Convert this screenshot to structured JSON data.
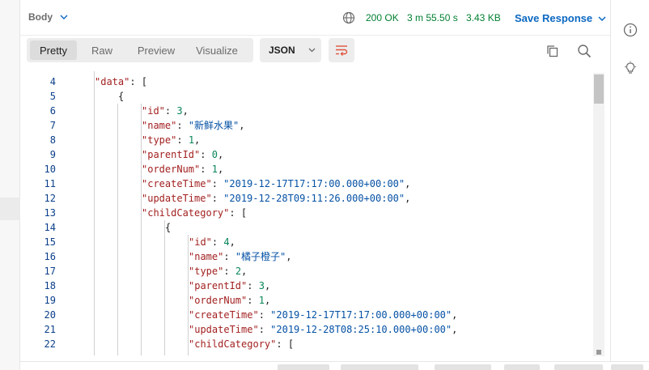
{
  "response": {
    "section_label": "Body",
    "status": "200 OK",
    "time": "3 m 55.50 s",
    "size": "3.43 KB",
    "save_label": "Save Response"
  },
  "view_tabs": [
    {
      "label": "Pretty",
      "active": true
    },
    {
      "label": "Raw",
      "active": false
    },
    {
      "label": "Preview",
      "active": false
    },
    {
      "label": "Visualize",
      "active": false
    }
  ],
  "format": {
    "selected": "JSON"
  },
  "icons": {
    "globe": "globe-icon",
    "wrap": "wrap-lines-icon",
    "copy": "copy-icon",
    "search": "search-icon",
    "info": "info-icon",
    "bulb": "lightbulb-icon"
  },
  "colors": {
    "status_ok": "#007f31",
    "accent": "#0b68c2",
    "wrap_icon": "#e0533d",
    "json_key": "#a32121",
    "json_string": "#0451a5",
    "json_number": "#098658"
  },
  "code_lines": [
    {
      "n": "4",
      "indent": 1,
      "tokens": [
        {
          "t": "key",
          "v": "\"data\""
        },
        {
          "t": "p",
          "v": ": ["
        }
      ]
    },
    {
      "n": "5",
      "indent": 2,
      "tokens": [
        {
          "t": "p",
          "v": "{"
        }
      ]
    },
    {
      "n": "6",
      "indent": 3,
      "tokens": [
        {
          "t": "key",
          "v": "\"id\""
        },
        {
          "t": "p",
          "v": ": "
        },
        {
          "t": "num",
          "v": "3"
        },
        {
          "t": "p",
          "v": ","
        }
      ]
    },
    {
      "n": "7",
      "indent": 3,
      "tokens": [
        {
          "t": "key",
          "v": "\"name\""
        },
        {
          "t": "p",
          "v": ": "
        },
        {
          "t": "str",
          "v": "\"新鲜水果\""
        },
        {
          "t": "p",
          "v": ","
        }
      ]
    },
    {
      "n": "8",
      "indent": 3,
      "tokens": [
        {
          "t": "key",
          "v": "\"type\""
        },
        {
          "t": "p",
          "v": ": "
        },
        {
          "t": "num",
          "v": "1"
        },
        {
          "t": "p",
          "v": ","
        }
      ]
    },
    {
      "n": "9",
      "indent": 3,
      "tokens": [
        {
          "t": "key",
          "v": "\"parentId\""
        },
        {
          "t": "p",
          "v": ": "
        },
        {
          "t": "num",
          "v": "0"
        },
        {
          "t": "p",
          "v": ","
        }
      ]
    },
    {
      "n": "10",
      "indent": 3,
      "tokens": [
        {
          "t": "key",
          "v": "\"orderNum\""
        },
        {
          "t": "p",
          "v": ": "
        },
        {
          "t": "num",
          "v": "1"
        },
        {
          "t": "p",
          "v": ","
        }
      ]
    },
    {
      "n": "11",
      "indent": 3,
      "tokens": [
        {
          "t": "key",
          "v": "\"createTime\""
        },
        {
          "t": "p",
          "v": ": "
        },
        {
          "t": "str",
          "v": "\"2019-12-17T17:17:00.000+00:00\""
        },
        {
          "t": "p",
          "v": ","
        }
      ]
    },
    {
      "n": "12",
      "indent": 3,
      "tokens": [
        {
          "t": "key",
          "v": "\"updateTime\""
        },
        {
          "t": "p",
          "v": ": "
        },
        {
          "t": "str",
          "v": "\"2019-12-28T09:11:26.000+00:00\""
        },
        {
          "t": "p",
          "v": ","
        }
      ]
    },
    {
      "n": "13",
      "indent": 3,
      "tokens": [
        {
          "t": "key",
          "v": "\"childCategory\""
        },
        {
          "t": "p",
          "v": ": ["
        }
      ]
    },
    {
      "n": "14",
      "indent": 4,
      "tokens": [
        {
          "t": "p",
          "v": "{"
        }
      ]
    },
    {
      "n": "15",
      "indent": 5,
      "tokens": [
        {
          "t": "key",
          "v": "\"id\""
        },
        {
          "t": "p",
          "v": ": "
        },
        {
          "t": "num",
          "v": "4"
        },
        {
          "t": "p",
          "v": ","
        }
      ]
    },
    {
      "n": "16",
      "indent": 5,
      "tokens": [
        {
          "t": "key",
          "v": "\"name\""
        },
        {
          "t": "p",
          "v": ": "
        },
        {
          "t": "str",
          "v": "\"橘子橙子\""
        },
        {
          "t": "p",
          "v": ","
        }
      ]
    },
    {
      "n": "17",
      "indent": 5,
      "tokens": [
        {
          "t": "key",
          "v": "\"type\""
        },
        {
          "t": "p",
          "v": ": "
        },
        {
          "t": "num",
          "v": "2"
        },
        {
          "t": "p",
          "v": ","
        }
      ]
    },
    {
      "n": "18",
      "indent": 5,
      "tokens": [
        {
          "t": "key",
          "v": "\"parentId\""
        },
        {
          "t": "p",
          "v": ": "
        },
        {
          "t": "num",
          "v": "3"
        },
        {
          "t": "p",
          "v": ","
        }
      ]
    },
    {
      "n": "19",
      "indent": 5,
      "tokens": [
        {
          "t": "key",
          "v": "\"orderNum\""
        },
        {
          "t": "p",
          "v": ": "
        },
        {
          "t": "num",
          "v": "1"
        },
        {
          "t": "p",
          "v": ","
        }
      ]
    },
    {
      "n": "20",
      "indent": 5,
      "tokens": [
        {
          "t": "key",
          "v": "\"createTime\""
        },
        {
          "t": "p",
          "v": ": "
        },
        {
          "t": "str",
          "v": "\"2019-12-17T17:17:00.000+00:00\""
        },
        {
          "t": "p",
          "v": ","
        }
      ]
    },
    {
      "n": "21",
      "indent": 5,
      "tokens": [
        {
          "t": "key",
          "v": "\"updateTime\""
        },
        {
          "t": "p",
          "v": ": "
        },
        {
          "t": "str",
          "v": "\"2019-12-28T08:25:10.000+00:00\""
        },
        {
          "t": "p",
          "v": ","
        }
      ]
    },
    {
      "n": "22",
      "indent": 5,
      "tokens": [
        {
          "t": "key",
          "v": "\"childCategory\""
        },
        {
          "t": "p",
          "v": ": ["
        }
      ]
    }
  ]
}
